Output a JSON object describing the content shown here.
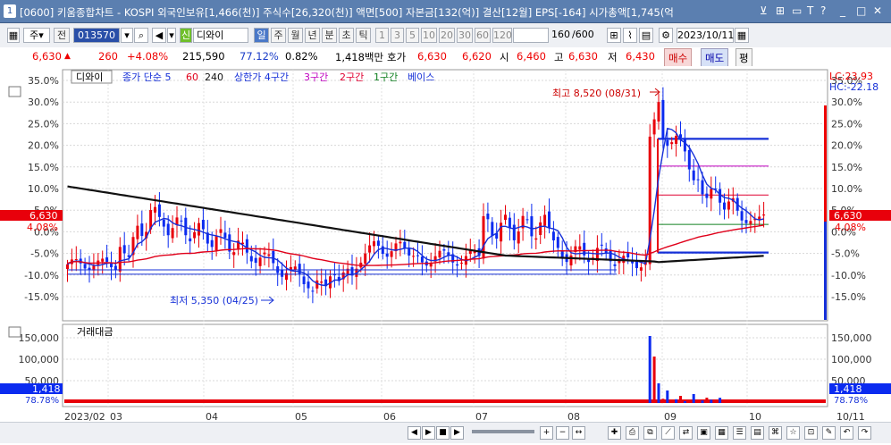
{
  "window": {
    "number": "1",
    "title": "[0600] 키움종합차트 - KOSPI 외국인보유[1,466(천)] 주식수[26,320(천)] 액면[500] 자본금[132(억)] 결산[12월] EPS[-164] 시가총액[1,745(억"
  },
  "toolbar": {
    "market_select": "주",
    "prev_label": "전",
    "code": "013570",
    "stock_name": "디와이",
    "credit_badge": "신",
    "periods": [
      "일",
      "주",
      "월",
      "년",
      "분",
      "초",
      "틱"
    ],
    "minute_steps": [
      "1",
      "3",
      "5",
      "10",
      "20",
      "30",
      "60",
      "120"
    ],
    "count": "160",
    "count_total": "/600",
    "date": "2023/10/11"
  },
  "price": {
    "current": "6,630",
    "change": "260",
    "change_pct": "+4.08%",
    "volume": "215,590",
    "vol_ratio": "77.12%",
    "turnover": "0.82%",
    "trade_value": "1,418백만",
    "quote_label": "호가",
    "ask": "6,630",
    "bid": "6,620",
    "open_label": "시",
    "open": "6,460",
    "high_label": "고",
    "high": "6,630",
    "low_label": "저",
    "low": "6,430",
    "buy_label": "매수",
    "sell_label": "매도",
    "avg_label": "평"
  },
  "chart": {
    "legend": {
      "name": "디와이",
      "ma": "종가 단순 5",
      "ma60": "60",
      "ma240": "240",
      "upper": "상한가 4구간",
      "sec3": "3구간",
      "sec2": "2구간",
      "sec1": "1구간",
      "base": "베이스"
    },
    "lc": "LC:23.93",
    "hc": "HC:-22.18",
    "y_ticks": [
      "35.0%",
      "30.0%",
      "25.0%",
      "20.0%",
      "15.0%",
      "10.0%",
      "5.0%",
      "0.0%",
      "-5.0%",
      "-10.0%",
      "-15.0%"
    ],
    "price_tag": "6,630",
    "pct_tag": "4.08%",
    "high_annot": "최고 8,520 (08/31)",
    "low_annot": "최저 5,350 (04/25)",
    "volume_label": "거래대금",
    "vol_ticks": [
      "150,000",
      "100,000",
      "50,000"
    ],
    "vol_tag": "1,418",
    "vol_pct": "78.78%",
    "x_labels": [
      "2023/02",
      "03",
      "04",
      "05",
      "06",
      "07",
      "08",
      "09",
      "10",
      "10/11"
    ]
  },
  "colors": {
    "up": "#e8000b",
    "down": "#0b2bf0",
    "ma5": "#1630d8",
    "ma60": "#e0001a",
    "ma240": "#111111",
    "sec3": "#c000c0",
    "sec2": "#e00030",
    "sec1": "#108020"
  }
}
